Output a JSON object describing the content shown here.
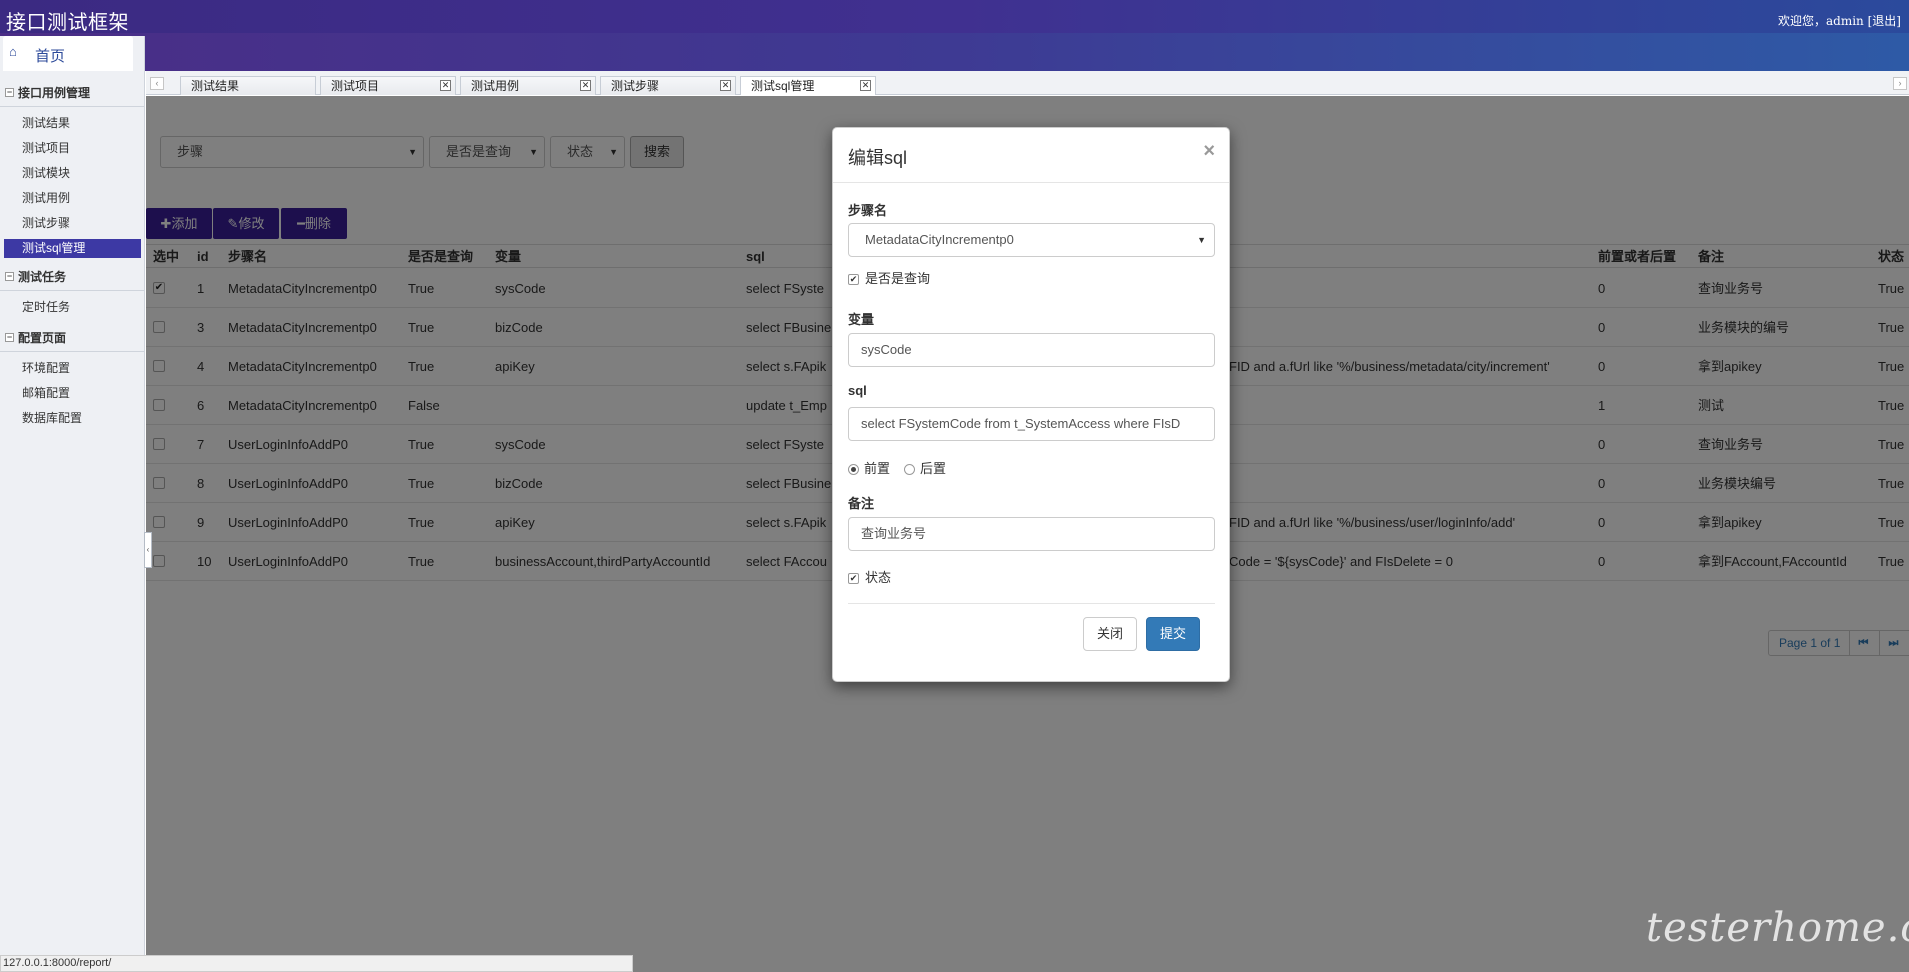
{
  "header": {
    "title": "接口测试框架",
    "welcome": "欢迎您，admin",
    "logout": "[退出]"
  },
  "sidebar": {
    "home_label": "首页",
    "groups": [
      {
        "title": "接口用例管理",
        "items": [
          "测试结果",
          "测试项目",
          "测试模块",
          "测试用例",
          "测试步骤",
          "测试sql管理"
        ],
        "active": 5
      },
      {
        "title": "测试任务",
        "items": [
          "定时任务"
        ]
      },
      {
        "title": "配置页面",
        "items": [
          "环境配置",
          "邮箱配置",
          "数据库配置"
        ]
      }
    ]
  },
  "tabs": [
    {
      "label": "测试结果",
      "closable": false
    },
    {
      "label": "测试项目",
      "closable": true
    },
    {
      "label": "测试用例",
      "closable": true
    },
    {
      "label": "测试步骤",
      "closable": true
    },
    {
      "label": "测试sql管理",
      "closable": true,
      "active": true
    }
  ],
  "search": {
    "step_select": "步骤",
    "query_select": "是否是查询",
    "status_select": "状态",
    "search_button": "搜索"
  },
  "toolbar": {
    "add": "✚添加",
    "edit": "✎修改",
    "delete": "━删除"
  },
  "grid": {
    "columns": [
      "选中",
      "id",
      "步骤名",
      "是否是查询",
      "变量",
      "sql",
      "前置或者后置",
      "备注",
      "状态"
    ],
    "rows": [
      {
        "checked": true,
        "id": "1",
        "step": "MetadataCityIncrementp0",
        "is_query": "True",
        "var": "sysCode",
        "sql": "select FSyste",
        "sql_tail": "",
        "pre": "0",
        "remark": "查询业务号",
        "status": "True"
      },
      {
        "checked": false,
        "id": "3",
        "step": "MetadataCityIncrementp0",
        "is_query": "True",
        "var": "bizCode",
        "sql": "select FBusine",
        "sql_tail": "",
        "pre": "0",
        "remark": "业务模块的编号",
        "status": "True"
      },
      {
        "checked": false,
        "id": "4",
        "step": "MetadataCityIncrementp0",
        "is_query": "True",
        "var": "apiKey",
        "sql": "select s.FApik",
        "sql_tail": "FID and a.fUrl like '%/business/metadata/city/increment'",
        "pre": "0",
        "remark": "拿到apikey",
        "status": "True"
      },
      {
        "checked": false,
        "id": "6",
        "step": "MetadataCityIncrementp0",
        "is_query": "False",
        "var": "",
        "sql": "update t_Emp",
        "sql_tail": "",
        "pre": "1",
        "remark": "测试",
        "status": "True"
      },
      {
        "checked": false,
        "id": "7",
        "step": "UserLoginInfoAddP0",
        "is_query": "True",
        "var": "sysCode",
        "sql": "select FSyste",
        "sql_tail": "",
        "pre": "0",
        "remark": "查询业务号",
        "status": "True"
      },
      {
        "checked": false,
        "id": "8",
        "step": "UserLoginInfoAddP0",
        "is_query": "True",
        "var": "bizCode",
        "sql": "select FBusine",
        "sql_tail": "",
        "pre": "0",
        "remark": "业务模块编号",
        "status": "True"
      },
      {
        "checked": false,
        "id": "9",
        "step": "UserLoginInfoAddP0",
        "is_query": "True",
        "var": "apiKey",
        "sql": "select s.FApik",
        "sql_tail": "FID and a.fUrl like '%/business/user/loginInfo/add'",
        "pre": "0",
        "remark": "拿到apikey",
        "status": "True"
      },
      {
        "checked": false,
        "id": "10",
        "step": "UserLoginInfoAddP0",
        "is_query": "True",
        "var": "businessAccount,thirdPartyAccountId",
        "sql": "select FAccou",
        "sql_tail": "Code = '${sysCode}' and FIsDelete = 0",
        "pre": "0",
        "remark": "拿到FAccount,FAccountId",
        "status": "True"
      }
    ]
  },
  "pager": {
    "info": "Page 1 of 1",
    "first": "⏮",
    "last": "⏭"
  },
  "modal": {
    "title": "编辑sql",
    "close_icon": "×",
    "step_label": "步骤名",
    "step_value": "MetadataCityIncrementp0",
    "is_query_label": "是否是查询",
    "is_query_checked": true,
    "var_label": "变量",
    "var_value": "sysCode",
    "sql_label": "sql",
    "sql_value": "select  FSystemCode from t_SystemAccess where FIsD",
    "pre_label": "前置",
    "post_label": "后置",
    "pre_selected": "前置",
    "remark_label": "备注",
    "remark_value": "查询业务号",
    "status_label": "状态",
    "status_checked": true,
    "close_button": "关闭",
    "submit_button": "提交"
  },
  "statusbar": "127.0.0.1:8000/report/",
  "watermark": "testerhome.com",
  "colors": {
    "header_start": "#3b2a82",
    "header_end": "#2b4a9c",
    "accent": "#3a1f9a",
    "primary_button": "#337ab7"
  }
}
